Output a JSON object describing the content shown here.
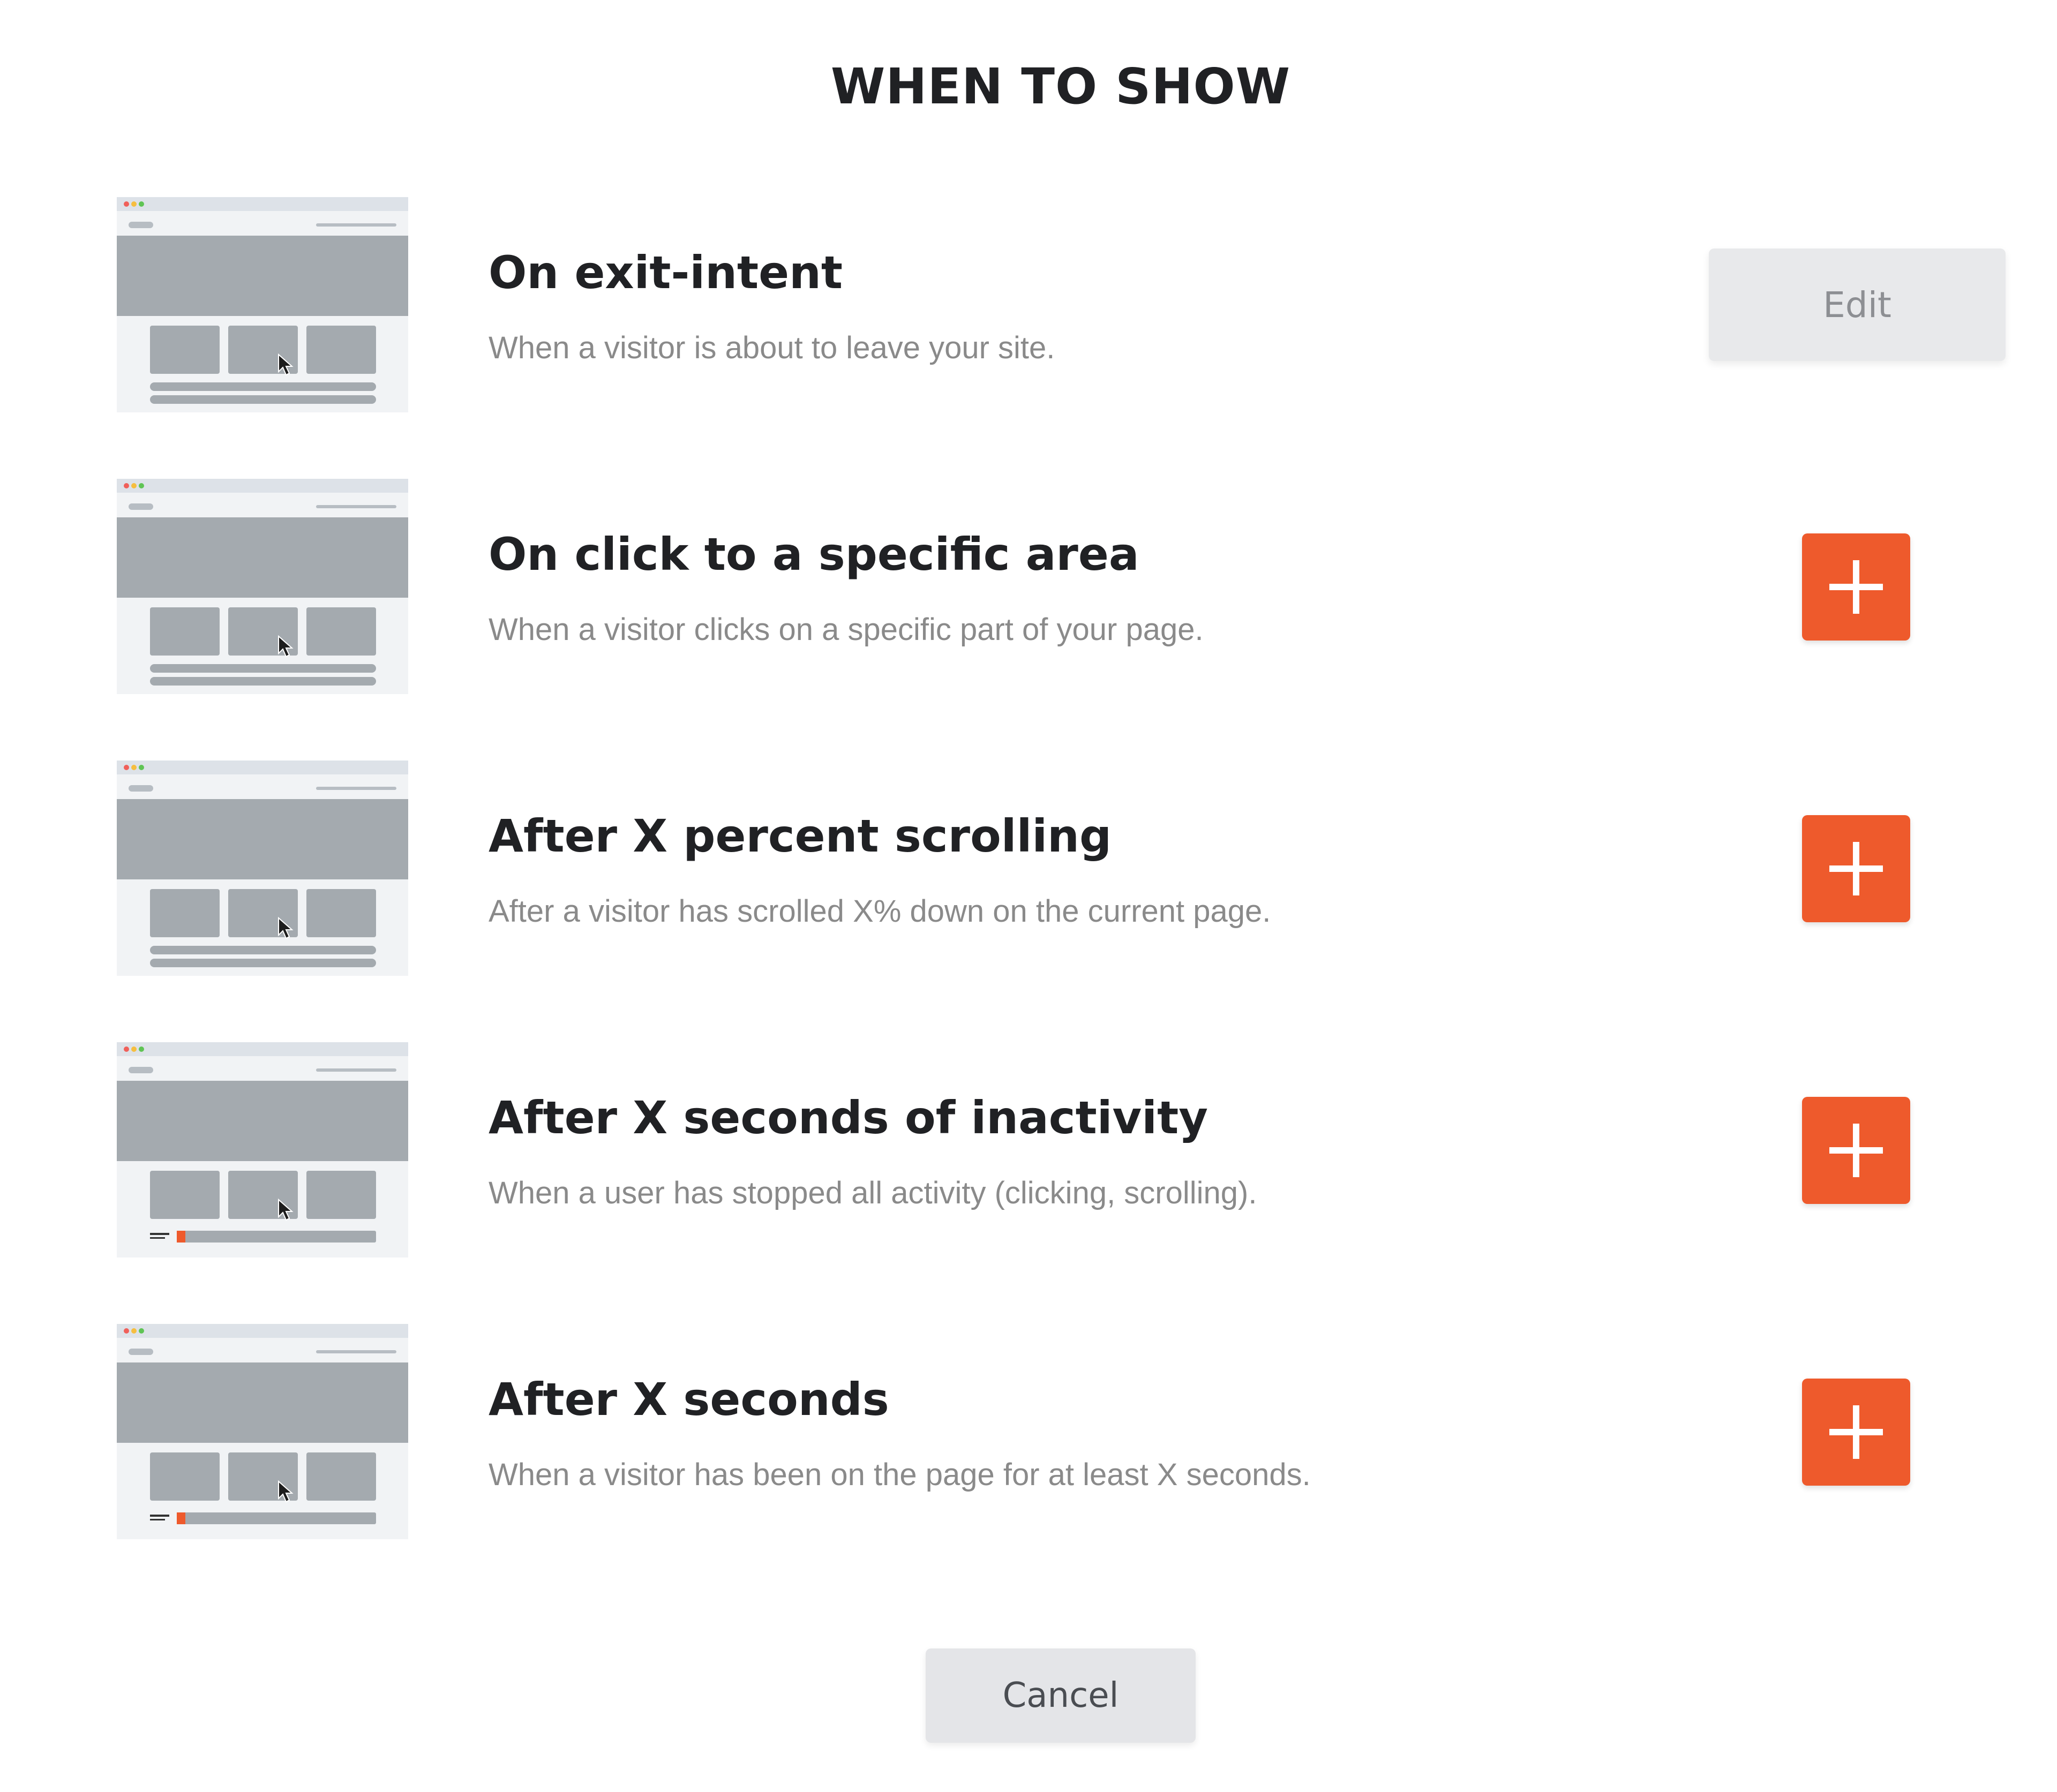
{
  "page": {
    "title": "WHEN TO SHOW"
  },
  "rows": [
    {
      "title": "On exit-intent",
      "description": "When a visitor is about to leave your site.",
      "action": "edit",
      "action_label": "Edit",
      "thumbnail": "browser-cards-thumbnail"
    },
    {
      "title": "On click to a specific area",
      "description": "When a visitor clicks on a specific part of your page.",
      "action": "add",
      "thumbnail": "browser-cards-thumbnail"
    },
    {
      "title": "After X percent scrolling",
      "description": "After a visitor has scrolled X% down on the current page.",
      "action": "add",
      "thumbnail": "browser-cards-thumbnail"
    },
    {
      "title": "After X seconds of inactivity",
      "description": "When a user has stopped all activity (clicking, scrolling).",
      "action": "add",
      "thumbnail": "browser-timer-thumbnail"
    },
    {
      "title": "After X seconds",
      "description": "When a visitor has been on the page for at least X seconds.",
      "action": "add",
      "thumbnail": "browser-timer-thumbnail"
    }
  ],
  "footer": {
    "cancel_label": "Cancel"
  },
  "colors": {
    "accent": "#ee5a2c",
    "title": "#202124",
    "muted": "#8a8a8a",
    "button_gray": "#e8e9eb"
  }
}
